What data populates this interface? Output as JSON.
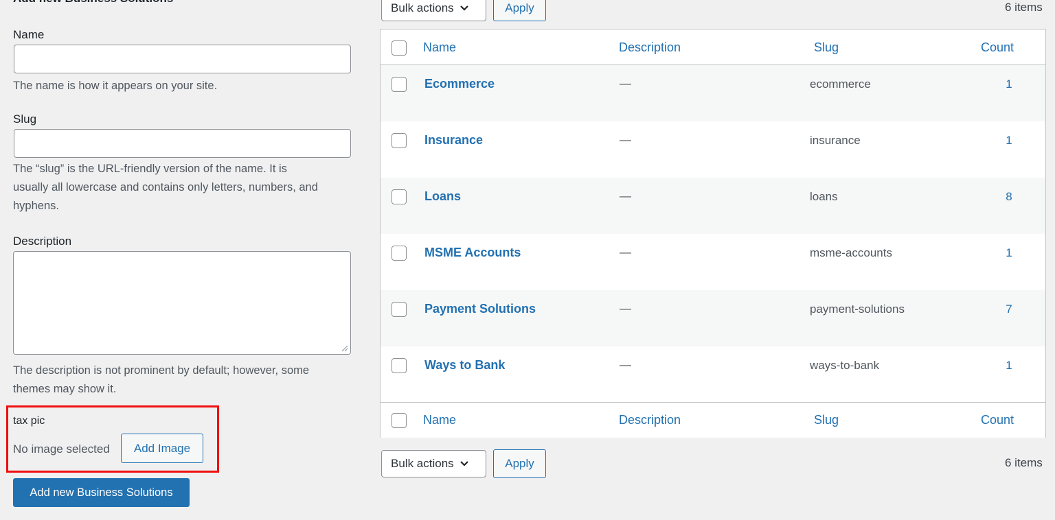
{
  "form": {
    "heading": "Add new Business Solutions",
    "name_label": "Name",
    "name_value": "",
    "name_help": "The name is how it appears on your site.",
    "slug_label": "Slug",
    "slug_value": "",
    "slug_help_lines": [
      "The “slug” is the URL-friendly version of the name. It is",
      "usually all lowercase and contains only letters, numbers, and",
      "hyphens."
    ],
    "description_label": "Description",
    "description_value": "",
    "description_help_lines": [
      "The description is not prominent by default; however, some",
      "themes may show it."
    ],
    "tax_pic_label": "tax pic",
    "no_image_text": "No image selected",
    "add_image_label": "Add Image",
    "submit_label": "Add new Business Solutions"
  },
  "bulk_top": {
    "select_label": "Bulk actions",
    "apply_label": "Apply",
    "items_count": "6 items"
  },
  "bulk_bottom": {
    "select_label": "Bulk actions",
    "apply_label": "Apply",
    "items_count": "6 items"
  },
  "table": {
    "columns": [
      "Name",
      "Description",
      "Slug",
      "Count"
    ],
    "rows": [
      {
        "name": "Ecommerce",
        "description": "—",
        "slug": "ecommerce",
        "count": "1"
      },
      {
        "name": "Insurance",
        "description": "—",
        "slug": "insurance",
        "count": "1"
      },
      {
        "name": "Loans",
        "description": "—",
        "slug": "loans",
        "count": "8"
      },
      {
        "name": "MSME Accounts",
        "description": "—",
        "slug": "msme-accounts",
        "count": "1"
      },
      {
        "name": "Payment Solutions",
        "description": "—",
        "slug": "payment-solutions",
        "count": "7"
      },
      {
        "name": "Ways to Bank",
        "description": "—",
        "slug": "ways-to-bank",
        "count": "1"
      }
    ]
  },
  "colors": {
    "accent": "#2271b1",
    "highlight": "#f00e0e",
    "background": "#f0f0f1"
  },
  "icons": {
    "dropdown": "chevron-down-icon",
    "resize": "resize-grip-icon"
  }
}
